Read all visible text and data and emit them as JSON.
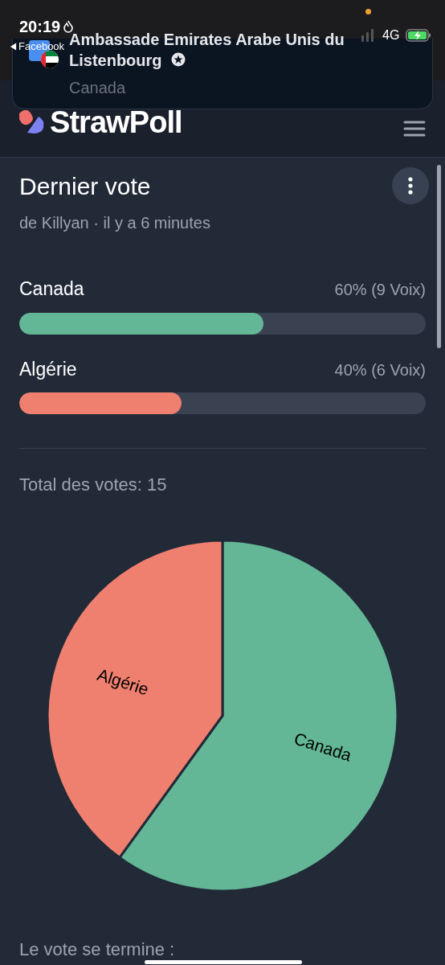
{
  "status_bar": {
    "time": "20:19",
    "back_link": "Facebook",
    "network": "4G"
  },
  "notification": {
    "title_lines": [
      "Ambassade Emirates Arabe Unis du",
      "Listenbourg"
    ],
    "message": "Canada"
  },
  "header": {
    "logo": "StrawPoll"
  },
  "poll": {
    "title": "Dernier vote",
    "subtitle": "de Killyan · il y a 6 minutes",
    "options": [
      {
        "label": "Canada",
        "result": "60% (9 Voix)",
        "level": 0.6,
        "color": "#63b796"
      },
      {
        "label": "Algérie",
        "result": "40% (6 Voix)",
        "level": 0.4,
        "color": "#ef806f"
      }
    ],
    "total": "Total des votes: 15",
    "chart_data": {
      "type": "pie",
      "categories": [
        "Canada",
        "Algérie"
      ],
      "values": [
        60,
        40
      ]
    },
    "end_label": "Le vote se termine :"
  }
}
